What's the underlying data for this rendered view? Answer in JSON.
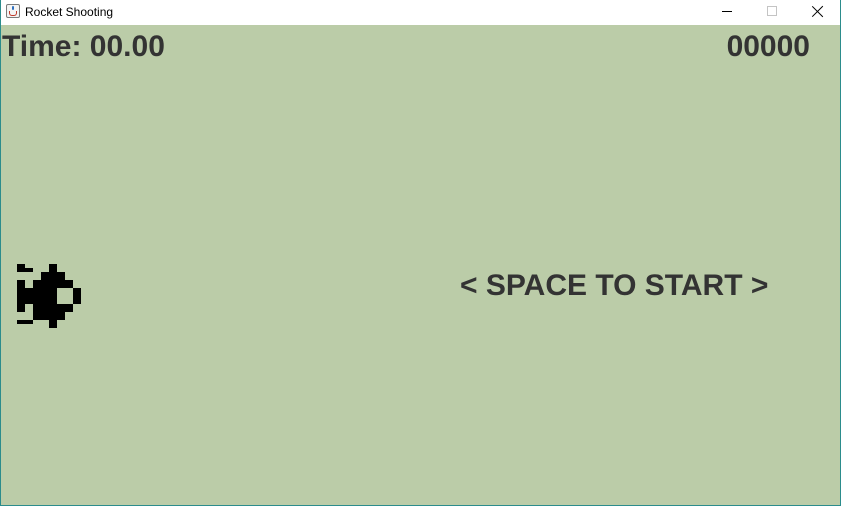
{
  "window": {
    "title": "Rocket Shooting",
    "icon": "java-cup-icon",
    "controls": [
      "minimize-icon",
      "maximize-icon",
      "close-icon"
    ]
  },
  "hud": {
    "time_label": "Time: 00.00",
    "score": "00000"
  },
  "prompt": {
    "text": "< SPACE TO START >"
  },
  "colors": {
    "background": "#bbcca8",
    "text": "#333333",
    "sprite": "#000000"
  }
}
